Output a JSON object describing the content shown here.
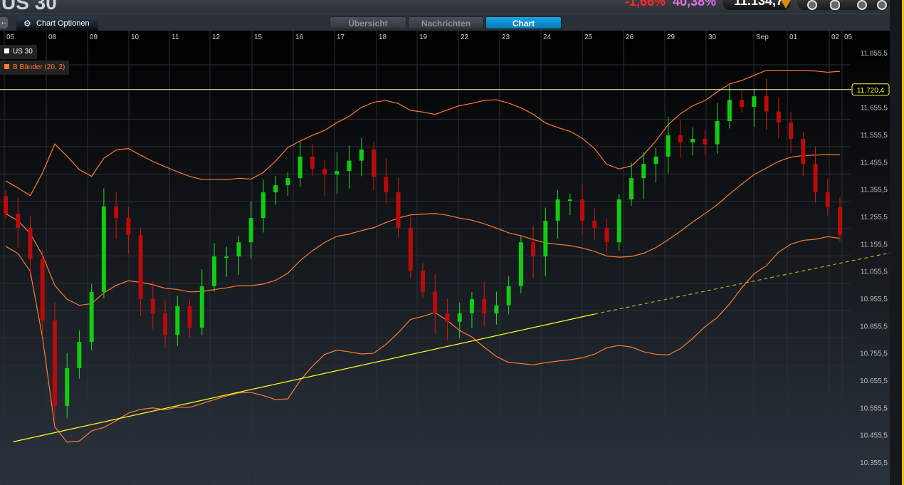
{
  "header": {
    "title": "US 30",
    "change": "-1,66%",
    "percent": "40,38%",
    "price": "11.134,7",
    "price_direction": "down"
  },
  "toolbar": {
    "back_icon": "arrow-left-icon",
    "options_label": "Chart Optionen",
    "options_icon": "gear-icon",
    "tools": [
      "speedometer-icon",
      "headset-icon",
      "wheel-icon",
      "settings-icon"
    ]
  },
  "tabs": [
    {
      "label": "Übersicht",
      "active": false
    },
    {
      "label": "Nachrichten",
      "active": false
    },
    {
      "label": "Chart",
      "active": true
    }
  ],
  "legend": [
    {
      "label": "US 30",
      "color": "#ffffff"
    },
    {
      "label": "B Bänder (20, 2)",
      "color": "#ff7a30"
    }
  ],
  "chart_data": {
    "type": "candlestick",
    "x_tick_labels": [
      "05",
      "08",
      "09",
      "10",
      "11",
      "12",
      "15",
      "16",
      "17",
      "18",
      "19",
      "22",
      "23",
      "24",
      "25",
      "26",
      "29",
      "30",
      "Sep",
      "01",
      "02",
      "05"
    ],
    "y_tick_labels": [
      "11.855,5",
      "11.655,5",
      "11.555,5",
      "11.455,5",
      "11.355,5",
      "11.255,5",
      "11.155,5",
      "11.055,5",
      "10.955,5",
      "10.855,5",
      "10.755,5",
      "10.655,5",
      "10.555,5",
      "10.455,5",
      "10.355,5"
    ],
    "ylim": [
      10300,
      11940
    ],
    "first_open": 11330,
    "closes": [
      11266,
      11214,
      11100,
      10874,
      10561,
      10700,
      10796,
      10979,
      11292,
      11250,
      11188,
      10953,
      10900,
      10822,
      10927,
      10848,
      11000,
      11109,
      11109,
      11161,
      11250,
      11344,
      11370,
      11396,
      11475,
      11430,
      11409,
      11422,
      11460,
      11501,
      11400,
      11344,
      11214,
      11057,
      10980,
      10901,
      10870,
      10901,
      10953,
      10900,
      10930,
      11000,
      11161,
      11109,
      11240,
      11318,
      11318,
      11240,
      11214,
      11161,
      11318,
      11396,
      11448,
      11475,
      11553,
      11527,
      11540,
      11520,
      11605,
      11683,
      11657,
      11696,
      11640,
      11600,
      11540,
      11448,
      11344,
      11290,
      11188
    ],
    "indicator": {
      "name": "Bollinger Bands",
      "period": 20,
      "stddev": 2
    },
    "horizontal_line": {
      "value": 11720.4,
      "label": "11.720,4",
      "color": "#ffff40"
    },
    "trendline": {
      "start": [
        0.6,
        10430
      ],
      "solid_end": [
        48,
        10898
      ],
      "dashed_end": [
        72,
        11122
      ],
      "color": "#ffff20"
    },
    "colors": {
      "up": "#22dd22",
      "down": "#dd1111",
      "band": "#ff7a30"
    }
  }
}
